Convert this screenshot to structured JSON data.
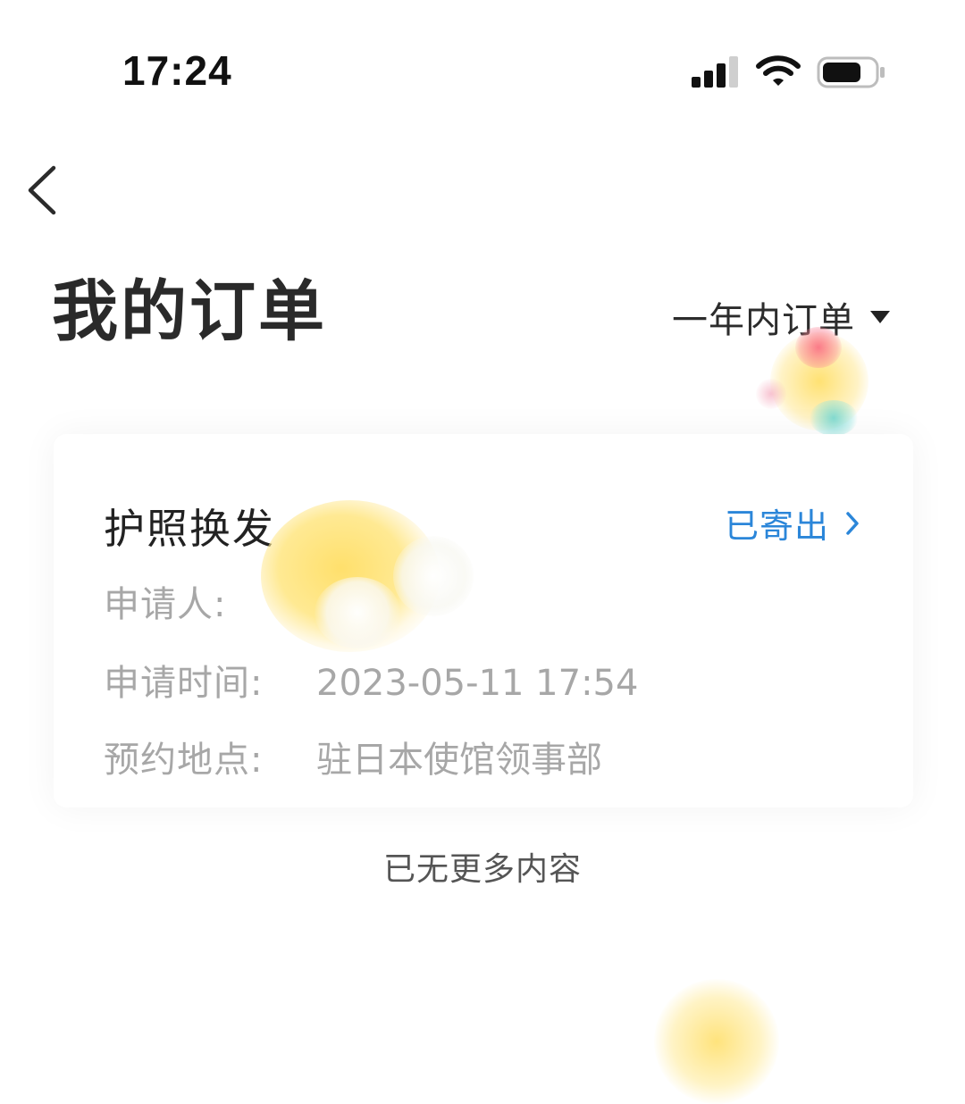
{
  "status_bar": {
    "time": "17:24"
  },
  "header": {
    "title": "我的订单",
    "filter_label": "一年内订单"
  },
  "order": {
    "title": "护照换发",
    "status": "已寄出",
    "rows": [
      {
        "label": "申请人:",
        "value": ""
      },
      {
        "label": "申请时间:",
        "value": "2023-05-11 17:54"
      },
      {
        "label": "预约地点:",
        "value": "驻日本使馆领事部"
      }
    ]
  },
  "footer": {
    "end_text": "已无更多内容"
  },
  "colors": {
    "accent": "#2b86d9",
    "title_text": "#2a2a2a",
    "muted_text": "#a7a7a7"
  },
  "icons": {
    "back": "chevron-left-icon",
    "filter": "caret-down-icon",
    "status": "chevron-right-icon"
  }
}
